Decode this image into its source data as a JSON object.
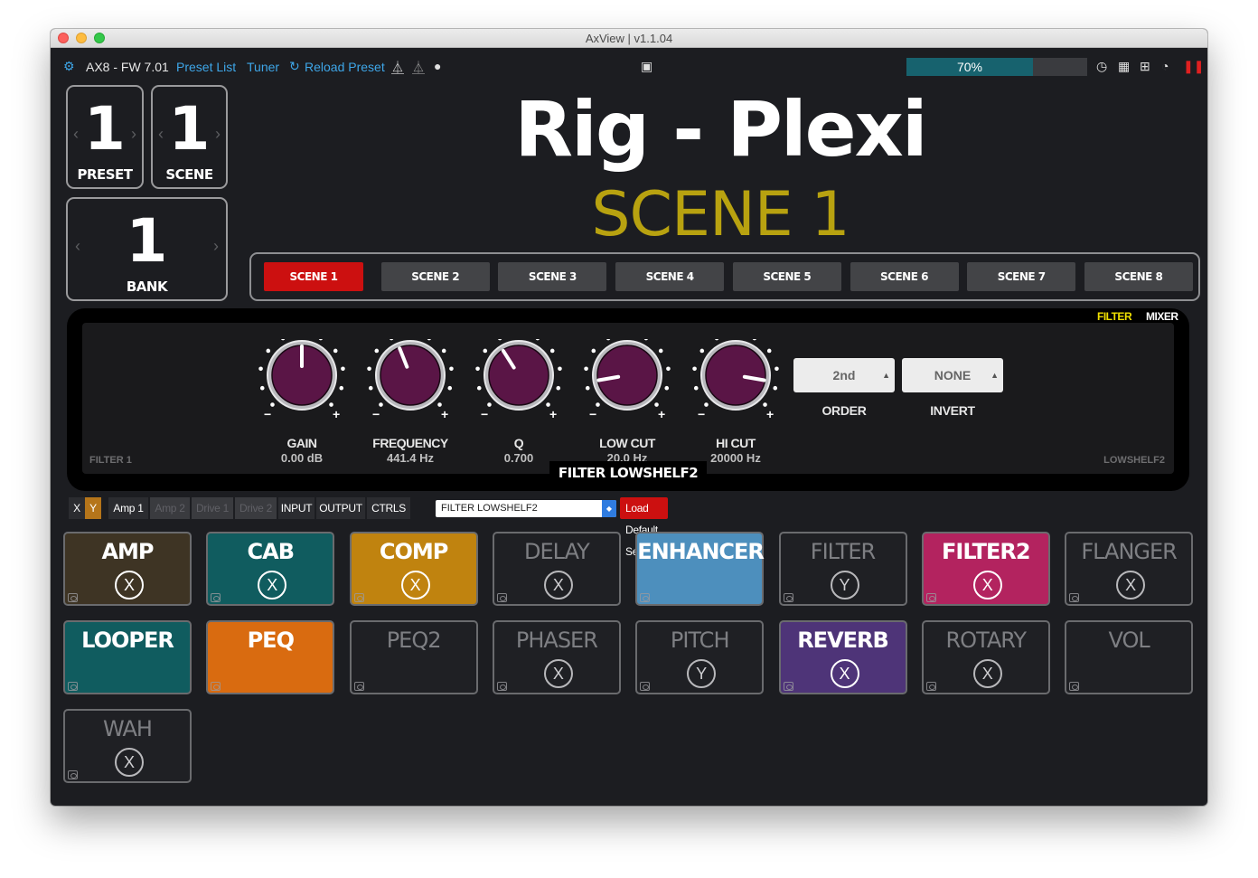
{
  "window": {
    "title": "AxView | v1.1.04"
  },
  "toolbar": {
    "device": "AX8 - FW 7.01",
    "preset_list": "Preset List",
    "tuner": "Tuner",
    "reload": "Reload Preset",
    "progress": {
      "percent": 70,
      "label": "70%"
    }
  },
  "preset": {
    "number": "1",
    "label": "PRESET"
  },
  "scene": {
    "number": "1",
    "label": "SCENE"
  },
  "bank": {
    "number": "1",
    "label": "BANK"
  },
  "rig_name": "Rig - Plexi",
  "scene_name": "SCENE 1",
  "scenes": [
    "SCENE 1",
    "SCENE 2",
    "SCENE 3",
    "SCENE 4",
    "SCENE 5",
    "SCENE 6",
    "SCENE 7",
    "SCENE 8"
  ],
  "active_scene": 0,
  "panel": {
    "tabs": {
      "filter": "FILTER",
      "mixer": "MIXER"
    },
    "knobs": [
      {
        "name": "GAIN",
        "value": "0.00 dB",
        "level": 0.5
      },
      {
        "name": "FREQUENCY",
        "value": "441.4 Hz",
        "level": 0.42
      },
      {
        "name": "Q",
        "value": "0.700",
        "level": 0.38
      },
      {
        "name": "LOW CUT",
        "value": "20.0 Hz",
        "level": 0.13
      },
      {
        "name": "HI CUT",
        "value": "20000 Hz",
        "level": 0.87
      }
    ],
    "order": {
      "value": "2nd",
      "label": "ORDER"
    },
    "invert": {
      "value": "NONE",
      "label": "INVERT"
    },
    "left_label": "FILTER 1",
    "right_label": "LOWSHELF2",
    "block_name": "FILTER LOWSHELF2"
  },
  "controls": {
    "x": "X",
    "y": "Y",
    "amp1": "Amp 1",
    "amp2": "Amp 2",
    "drive1": "Drive 1",
    "drive2": "Drive 2",
    "input": "INPUT",
    "output": "OUTPUT",
    "ctrls": "CTRLS",
    "dropdown_value": "FILTER LOWSHELF2",
    "load_default": "Load Default Settings"
  },
  "blocks": [
    {
      "name": "AMP",
      "state": "X",
      "color": "#3e3424",
      "on": true
    },
    {
      "name": "CAB",
      "state": "X",
      "color": "#105c5f",
      "on": true
    },
    {
      "name": "COMP",
      "state": "X",
      "color": "#c0830f",
      "on": true
    },
    {
      "name": "DELAY",
      "state": "X",
      "color": "#1f2024",
      "on": false
    },
    {
      "name": "ENHANCER",
      "state": "",
      "color": "#4d8fbd",
      "on": true
    },
    {
      "name": "FILTER",
      "state": "Y",
      "color": "#1f2024",
      "on": false
    },
    {
      "name": "FILTER2",
      "state": "X",
      "color": "#b3235f",
      "on": true
    },
    {
      "name": "FLANGER",
      "state": "X",
      "color": "#1f2024",
      "on": false
    },
    {
      "name": "LOOPER",
      "state": "",
      "color": "#105c5f",
      "on": true
    },
    {
      "name": "PEQ",
      "state": "",
      "color": "#d96b10",
      "on": true
    },
    {
      "name": "PEQ2",
      "state": "",
      "color": "#1f2024",
      "on": false
    },
    {
      "name": "PHASER",
      "state": "X",
      "color": "#1f2024",
      "on": false
    },
    {
      "name": "PITCH",
      "state": "Y",
      "color": "#1f2024",
      "on": false
    },
    {
      "name": "REVERB",
      "state": "X",
      "color": "#4e3478",
      "on": true
    },
    {
      "name": "ROTARY",
      "state": "X",
      "color": "#1f2024",
      "on": false
    },
    {
      "name": "VOL",
      "state": "",
      "color": "#1f2024",
      "on": false
    },
    {
      "name": "WAH",
      "state": "X",
      "color": "#1f2024",
      "on": false
    }
  ]
}
